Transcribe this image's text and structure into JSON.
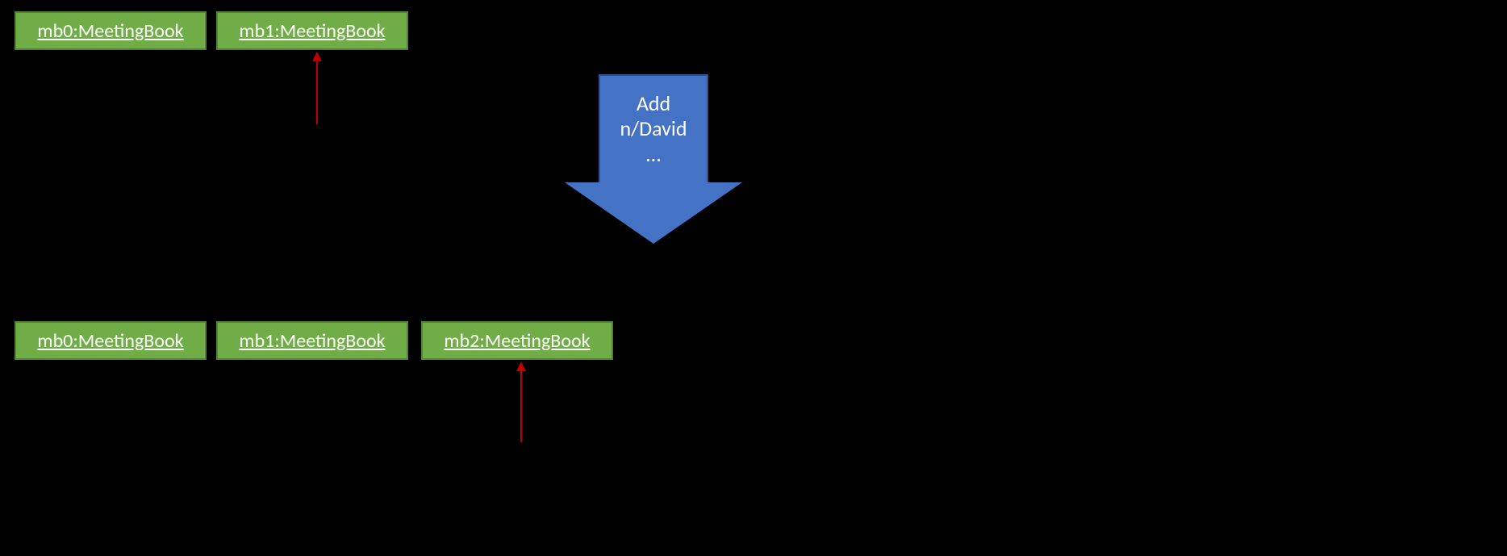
{
  "top": {
    "boxes": [
      {
        "label": "mb0:MeetingBook"
      },
      {
        "label": "mb1:MeetingBook"
      }
    ]
  },
  "bottom": {
    "boxes": [
      {
        "label": "mb0:MeetingBook"
      },
      {
        "label": "mb1:MeetingBook"
      },
      {
        "label": "mb2:MeetingBook"
      }
    ]
  },
  "action": {
    "line1": "Add",
    "line2": "n/David",
    "line3": "…"
  }
}
